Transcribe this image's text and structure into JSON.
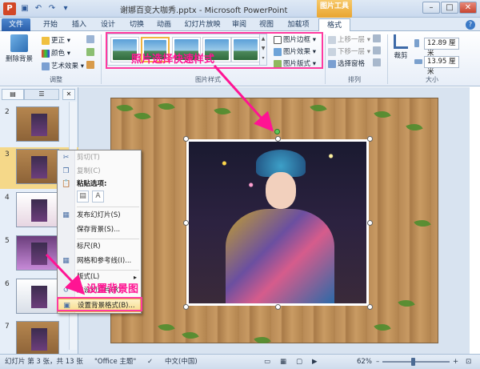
{
  "window": {
    "title": "谢娜百变大咖秀.pptx - Microsoft PowerPoint",
    "context_tab_title": "图片工具",
    "buttons": [
      "–",
      "□",
      "✕"
    ]
  },
  "tabs": [
    {
      "label": "文件"
    },
    {
      "label": "开始"
    },
    {
      "label": "插入"
    },
    {
      "label": "设计"
    },
    {
      "label": "切换"
    },
    {
      "label": "动画"
    },
    {
      "label": "幻灯片放映"
    },
    {
      "label": "审阅"
    },
    {
      "label": "视图"
    },
    {
      "label": "加载项"
    },
    {
      "label": "格式",
      "active": true
    }
  ],
  "ribbon": {
    "adjust": {
      "remove_bg": "删除背景",
      "corrections": "更正 ▾",
      "color": "颜色 ▾",
      "artistic": "艺术效果 ▾",
      "group_label": "调整"
    },
    "picture_styles": {
      "border": "图片边框 ▾",
      "effects": "图片效果 ▾",
      "layout": "图片版式 ▾",
      "group_label": "图片样式"
    },
    "arrange": {
      "bring_forward": "上移一层 ▾",
      "send_backward": "下移一层 ▾",
      "selection_pane": "选择窗格",
      "group_label": "排列"
    },
    "size": {
      "crop": "裁剪",
      "height": "12.89 厘米",
      "width": "13.95 厘米",
      "group_label": "大小"
    }
  },
  "annotations": {
    "quick_style": "照片选择快速样式",
    "set_background": "设置背景图"
  },
  "slides": [
    {
      "num": "2"
    },
    {
      "num": "3",
      "selected": true
    },
    {
      "num": "4"
    },
    {
      "num": "5"
    },
    {
      "num": "6"
    },
    {
      "num": "7"
    }
  ],
  "context_menu": {
    "items": [
      {
        "label": "剪切(T)",
        "disabled": true,
        "icon": "scissors-icon"
      },
      {
        "label": "复制(C)",
        "disabled": true,
        "icon": "copy-icon"
      },
      {
        "label": "粘贴选项:",
        "bold": true,
        "icon": "paste-icon"
      },
      {
        "label": "发布幻灯片(S)",
        "icon": "publish-icon"
      },
      {
        "label": "保存背景(S)...",
        "icon": ""
      },
      {
        "label": "标尺(R)",
        "icon": ""
      },
      {
        "label": "网格和参考线(I)...",
        "icon": "grid-icon"
      },
      {
        "label": "版式(L)",
        "submenu": true,
        "icon": ""
      },
      {
        "label": "重设幻灯片(R)",
        "icon": "reset-icon"
      },
      {
        "label": "设置背景格式(B)...",
        "highlighted": true,
        "icon": "background-icon"
      }
    ]
  },
  "status_bar": {
    "slide_info": "幻灯片 第 3 张，共 13 张",
    "theme": "\"Office 主题\"",
    "language": "中文(中国)",
    "zoom": "62%"
  },
  "colors": {
    "accent": "#2a5ea9",
    "context_tab": "#e9a530",
    "annotation": "#ff1493"
  }
}
